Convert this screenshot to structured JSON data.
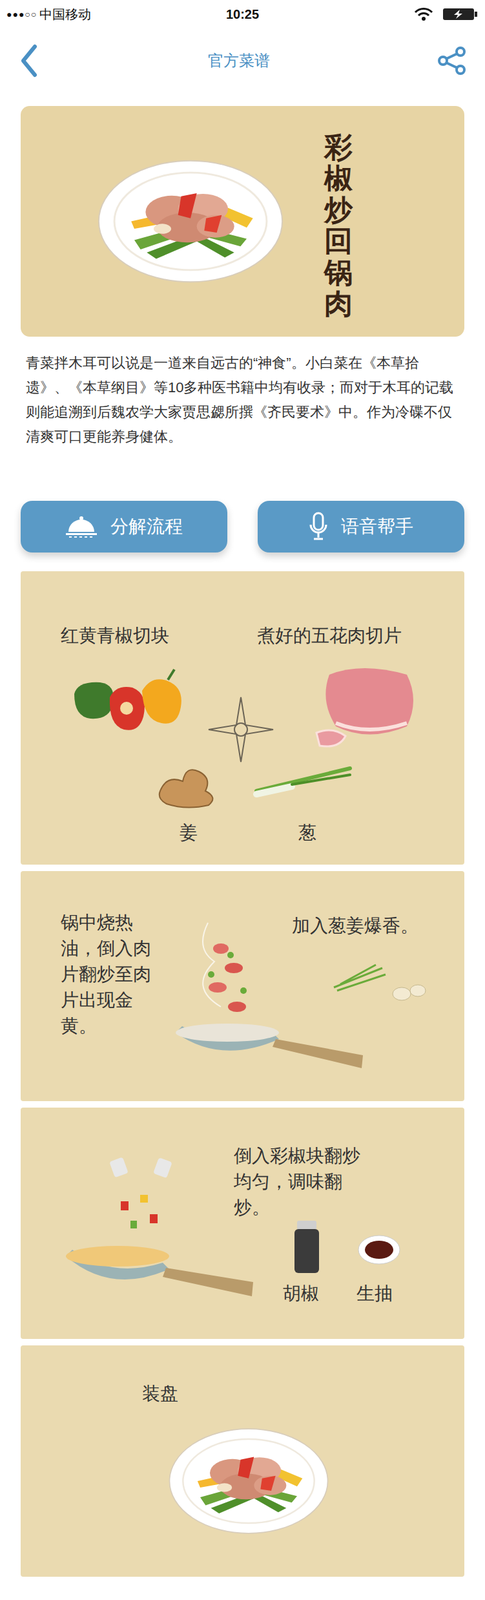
{
  "status_bar": {
    "signal": "●●●○○",
    "carrier": "中国移动",
    "time": "10:25"
  },
  "nav": {
    "title": "官方菜谱"
  },
  "recipe": {
    "title": "彩椒炒回锅肉",
    "description": "青菜拌木耳可以说是一道来自远古的“神食”。小白菜在《本草拾遗》、《本草纲目》等10多种医书籍中均有收录；而对于木耳的记载则能追溯到后魏农学大家贾思勰所撰《齐民要术》中。作为冷碟不仅清爽可口更能养身健体。"
  },
  "buttons": [
    {
      "label": "分解流程",
      "kind": "steps"
    },
    {
      "label": "语音帮手",
      "kind": "voice"
    }
  ],
  "steps": [
    {
      "kind": "prep",
      "labels": [
        "红黄青椒切块",
        "煮好的五花肉切片",
        "姜",
        "葱"
      ]
    },
    {
      "kind": "fry",
      "labels": [
        "锅中烧热油，倒入肉片翻炒至肉片出现金黄。",
        "加入葱姜爆香。"
      ]
    },
    {
      "kind": "season",
      "labels": [
        "倒入彩椒块翻炒均匀，调味翻炒。",
        "胡椒",
        "生抽"
      ]
    },
    {
      "kind": "plate",
      "labels": [
        "装盘"
      ]
    }
  ]
}
